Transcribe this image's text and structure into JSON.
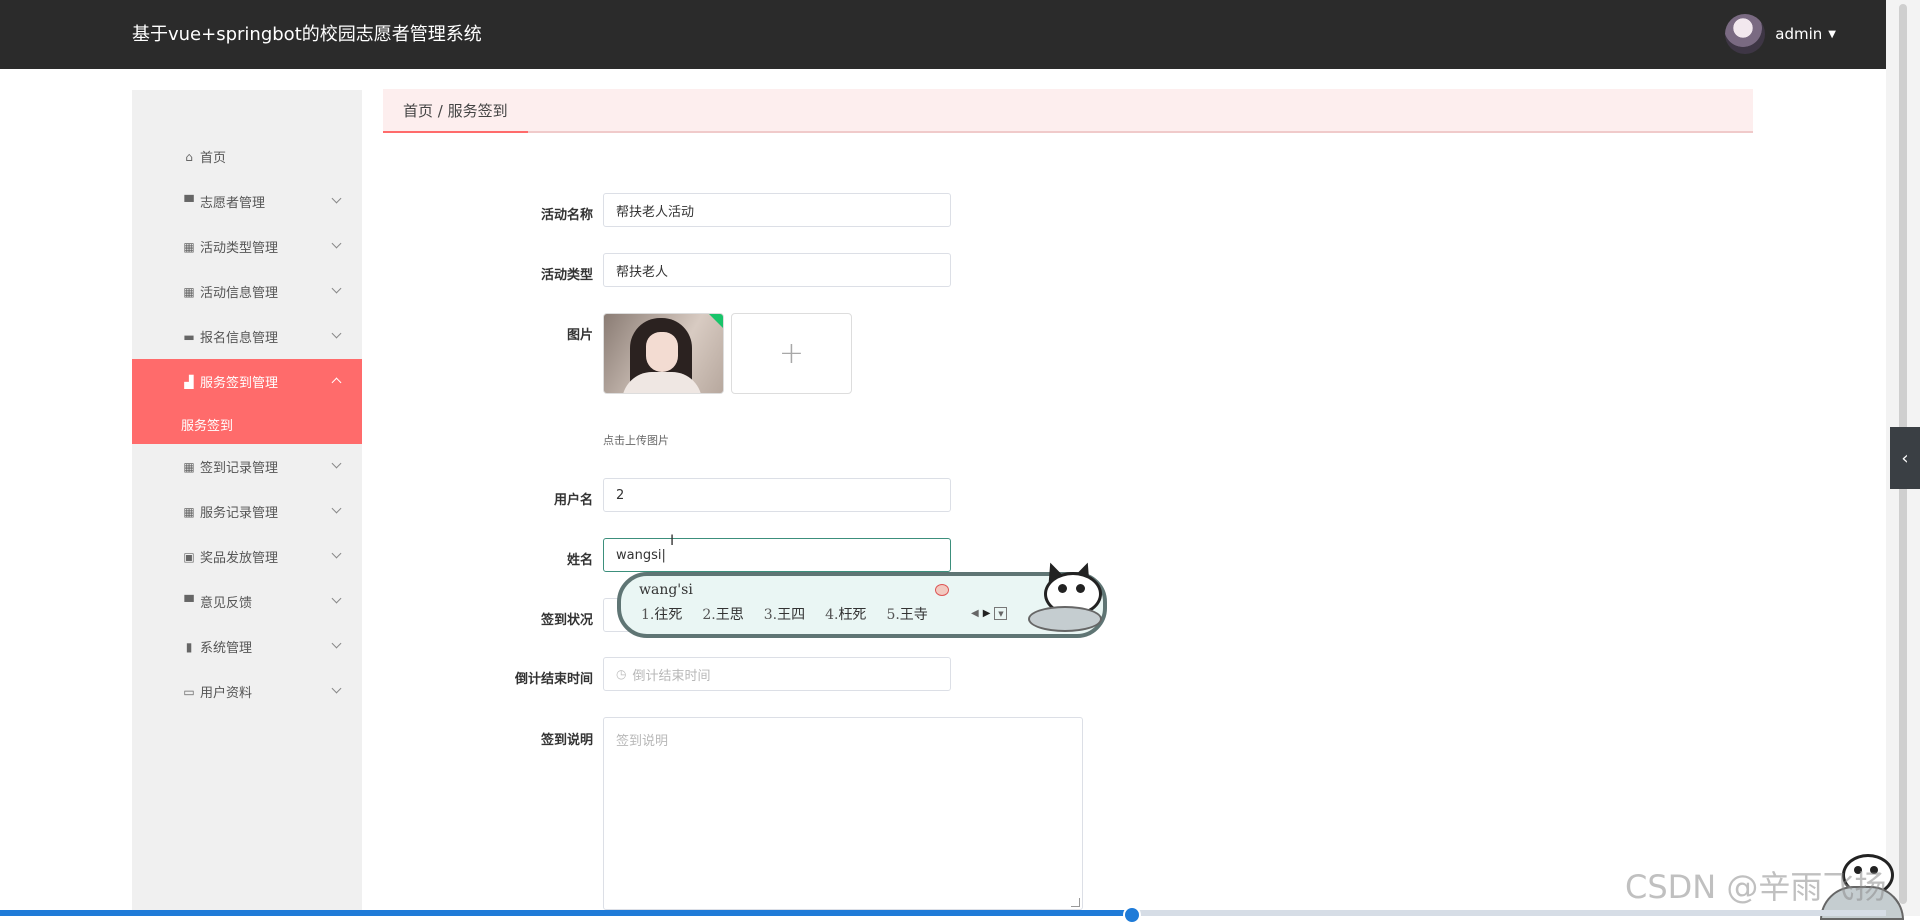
{
  "header": {
    "title": "基于vue+springbot的校园志愿者管理系统",
    "username": "admin"
  },
  "sidebar": {
    "items": [
      {
        "label": "首页",
        "icon": "home-icon",
        "glyph": "⌂",
        "expandable": false
      },
      {
        "label": "志愿者管理",
        "icon": "monitor-icon",
        "glyph": "▀",
        "expandable": true
      },
      {
        "label": "活动类型管理",
        "icon": "grid-icon",
        "glyph": "▦",
        "expandable": true
      },
      {
        "label": "活动信息管理",
        "icon": "grid-icon",
        "glyph": "▦",
        "expandable": true
      },
      {
        "label": "报名信息管理",
        "icon": "ticket-icon",
        "glyph": "▬",
        "expandable": true
      },
      {
        "label": "服务签到管理",
        "icon": "thumb-icon",
        "glyph": "▟",
        "expandable": true,
        "active": true
      },
      {
        "label": "签到记录管理",
        "icon": "grid-icon",
        "glyph": "▦",
        "expandable": true
      },
      {
        "label": "服务记录管理",
        "icon": "grid-icon",
        "glyph": "▦",
        "expandable": true
      },
      {
        "label": "奖品发放管理",
        "icon": "clipboard-icon",
        "glyph": "▣",
        "expandable": true
      },
      {
        "label": "意见反馈",
        "icon": "monitor-icon",
        "glyph": "▀",
        "expandable": true
      },
      {
        "label": "系统管理",
        "icon": "bar-chart-icon",
        "glyph": "▮",
        "expandable": true
      },
      {
        "label": "用户资料",
        "icon": "card-icon",
        "glyph": "▭",
        "expandable": true
      }
    ],
    "submenu": {
      "label": "服务签到"
    }
  },
  "breadcrumb": {
    "text": "首页 / 服务签到"
  },
  "form": {
    "activity_name": {
      "label": "活动名称",
      "value": "帮扶老人活动"
    },
    "activity_type": {
      "label": "活动类型",
      "value": "帮扶老人"
    },
    "image": {
      "label": "图片",
      "upload_hint": "点击上传图片",
      "plus": "+"
    },
    "username": {
      "label": "用户名",
      "value": "2"
    },
    "name": {
      "label": "姓名",
      "value": "wangsi"
    },
    "status": {
      "label": "签到状况"
    },
    "countdown": {
      "label": "倒计结束时间",
      "placeholder": "倒计结束时间"
    },
    "remark": {
      "label": "签到说明",
      "placeholder": "签到说明"
    }
  },
  "ime": {
    "pinyin": "wang'si",
    "candidates": [
      {
        "num": "1.",
        "text": "往死"
      },
      {
        "num": "2.",
        "text": "王思"
      },
      {
        "num": "3.",
        "text": "王四"
      },
      {
        "num": "4.",
        "text": "枉死"
      },
      {
        "num": "5.",
        "text": "王寺"
      }
    ]
  },
  "watermark": "CSDN @辛雨飞扬",
  "video_progress": 0.6,
  "colors": {
    "accent": "#ff6b6b",
    "header_bg": "#2b2b2b",
    "sidebar_bg": "#f0f0f0",
    "focus_border": "#3c8f7c"
  }
}
